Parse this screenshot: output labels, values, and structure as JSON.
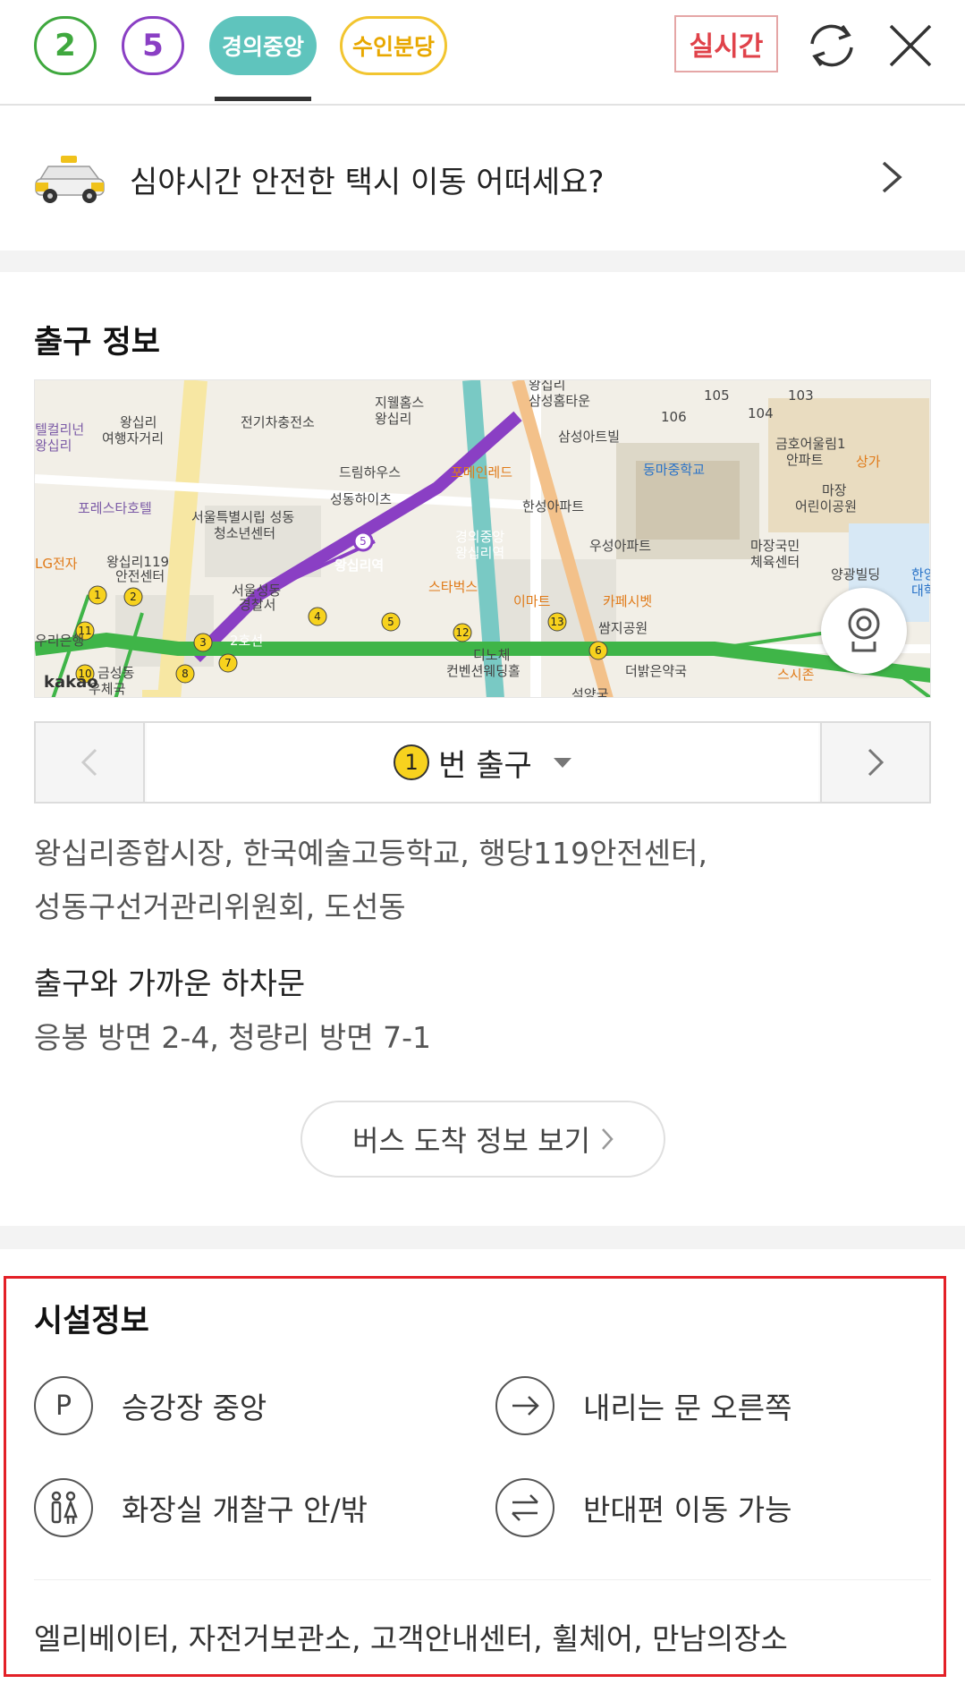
{
  "header": {
    "lines": [
      {
        "label": "2",
        "color": "#3fa83e"
      },
      {
        "label": "5",
        "color": "#8a3fc4"
      },
      {
        "label": "경의중앙",
        "color": "#5fc4bd"
      },
      {
        "label": "수인분당",
        "color": "#f2c530"
      }
    ],
    "realtime_label": "실시간"
  },
  "promo": {
    "text": "심야시간 안전한 택시 이동 어떠세요?"
  },
  "exit_info": {
    "title": "출구 정보",
    "map": {
      "labels": [
        "지웰홈스 왕십리",
        "왕십리 삼성홈타운",
        "전기차충전소",
        "왕십리 여행자거리",
        "텔컬리넌 왕십리",
        "삼성아트빌",
        "동마중학교",
        "금호어울림1 안파트",
        "상가",
        "마장 어린이공원",
        "드림하우스",
        "성동하이츠",
        "포메인레드",
        "한성아파트",
        "포레스타호텔",
        "서울특별시립 성동 청소년센터",
        "왕십리119 안전센터",
        "왕십리역",
        "경의중앙 왕십리역",
        "우성아파트",
        "마장국민 체육센터",
        "양광빌딩",
        "서울성동 경찰서",
        "스타벅스",
        "이마트",
        "카페시벳",
        "쌈지공원",
        "우리은행",
        "2호선",
        "디노체 컨벤션웨딩홀",
        "더밝은약국",
        "스시존",
        "금성동 우체국",
        "한양대학",
        "석양국",
        "105",
        "104",
        "106",
        "103"
      ],
      "logo": "kakao"
    },
    "exit": {
      "number": "1",
      "label": "번 출구"
    },
    "nearby": "왕십리종합시장, 한국예술고등학교, 행당119안전센터,",
    "nearby_line2": "성동구선거관리위원회, 도선동",
    "bus_stop_title": "출구와 가까운 하차문",
    "bus_stop_text": "응봉 방면 2-4, 청량리 방면 7-1",
    "bus_button": "버스 도착 정보 보기"
  },
  "facility": {
    "title": "시설정보",
    "items": [
      {
        "icon": "parking-icon",
        "label": "승강장 중앙"
      },
      {
        "icon": "arrow-right-icon",
        "label": "내리는 문 오른쪽"
      },
      {
        "icon": "restroom-icon",
        "label": "화장실 개찰구 안/밖"
      },
      {
        "icon": "swap-icon",
        "label": "반대편 이동 가능"
      }
    ],
    "extra": "엘리베이터, 자전거보관소, 고객안내센터, 휠체어, 만남의장소"
  }
}
